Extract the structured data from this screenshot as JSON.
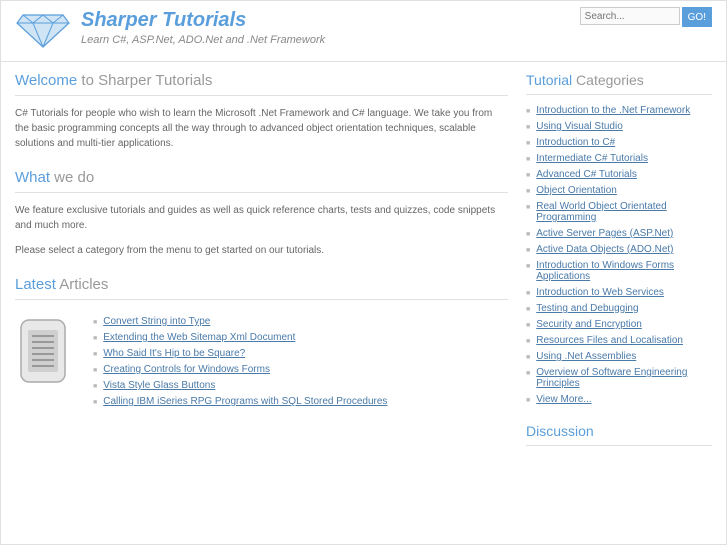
{
  "header": {
    "site_title": "Sharper Tutorials",
    "tagline": "Learn C#, ASP.Net, ADO.Net and .Net Framework",
    "search_placeholder": "Search...",
    "go_label": "GO!"
  },
  "welcome": {
    "w1": "Welcome",
    "w2": " to Sharper Tutorials",
    "body": "C# Tutorials for people who wish to learn the Microsoft .Net Framework and C# language. We take you from the basic programming concepts all the way through to advanced object orientation techniques, scalable solutions and multi-tier applications."
  },
  "what": {
    "w1": "What",
    "w2": " we do",
    "p1": "We feature exclusive tutorials and guides as well as quick reference charts, tests and quizzes, code snippets and much more.",
    "p2": "Please select a category from the menu to get started on our tutorials."
  },
  "latest": {
    "w1": "Latest",
    "w2": " Articles",
    "items": [
      "Convert String into Type",
      "Extending the Web Sitemap Xml Document",
      "Who Said It's Hip to be Square?",
      "Creating Controls for Windows Forms",
      "Vista Style Glass Buttons",
      "Calling IBM iSeries RPG Programs with SQL Stored Procedures"
    ]
  },
  "categories": {
    "w1": "Tutorial",
    "w2": " Categories",
    "items": [
      "Introduction to the .Net Framework",
      "Using Visual Studio",
      "Introduction to C#",
      "Intermediate C# Tutorials",
      "Advanced C# Tutorials",
      "Object Orientation",
      "Real World Object Orientated Programming",
      "Active Server Pages (ASP.Net)",
      "Active Data Objects (ADO.Net)",
      "Introduction to Windows Forms Applications",
      "Introduction to Web Services",
      "Testing and Debugging",
      "Security and Encryption",
      "Resources Files and Localisation",
      "Using .Net Assemblies",
      "Overview of Software Engineering Principles",
      "View More..."
    ]
  },
  "discussion": {
    "w1": "Discussion",
    "w2": ""
  }
}
